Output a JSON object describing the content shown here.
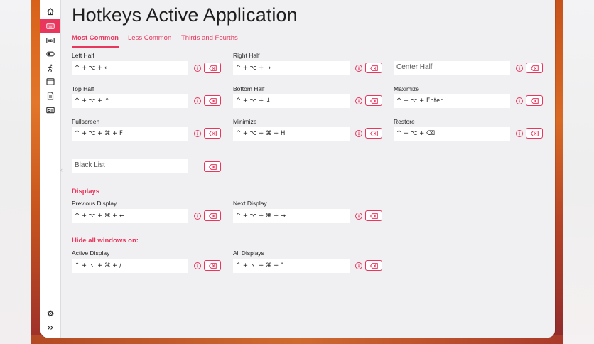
{
  "title": "Hotkeys Active Application",
  "tabs": [
    {
      "label": "Most Common"
    },
    {
      "label": "Less Common"
    },
    {
      "label": "Thirds and Fourths"
    }
  ],
  "accent_color": "#e8365c",
  "sidebar": {
    "items": [
      {
        "icon": "home-icon"
      },
      {
        "icon": "keyboard-icon"
      },
      {
        "icon": "text-box-icon"
      },
      {
        "icon": "toggle-icon"
      },
      {
        "icon": "running-person-icon"
      },
      {
        "icon": "window-icon"
      },
      {
        "icon": "document-icon"
      },
      {
        "icon": "id-card-icon"
      }
    ],
    "settings_icon": "gear-icon",
    "expand_icon": "double-chevron-right-icon"
  },
  "hotkeys": [
    {
      "label": "Left Half",
      "value": "^ + ⌥ + ←"
    },
    {
      "label": "Right Half",
      "value": "^ + ⌥ + →"
    },
    {
      "label": "",
      "value": "",
      "placeholder": "Center Half"
    },
    {
      "label": "Top Half",
      "value": "^ + ⌥ + ↑"
    },
    {
      "label": "Bottom Half",
      "value": "^ + ⌥ + ↓"
    },
    {
      "label": "Maximize",
      "value": "^ + ⌥ + Enter"
    },
    {
      "label": "Fullscreen",
      "value": "^ + ⌥ + ⌘ + F"
    },
    {
      "label": "Minimize",
      "value": "^ + ⌥ + ⌘ + H"
    },
    {
      "label": "Restore",
      "value": "^ + ⌥ + ⌫"
    },
    {
      "label": "",
      "value": "",
      "placeholder": "Black List"
    }
  ],
  "displays": {
    "header": "Displays",
    "items": [
      {
        "label": "Previous Display",
        "value": "^ + ⌥ + ⌘ + ←"
      },
      {
        "label": "Next Display",
        "value": "^ + ⌥ + ⌘ + →"
      }
    ]
  },
  "hide_all": {
    "header": "Hide all windows on:",
    "items": [
      {
        "label": "Active Display",
        "value": "^ + ⌥ + ⌘ + /"
      },
      {
        "label": "All Displays",
        "value": "^ + ⌥ + ⌘ + \""
      }
    ]
  }
}
